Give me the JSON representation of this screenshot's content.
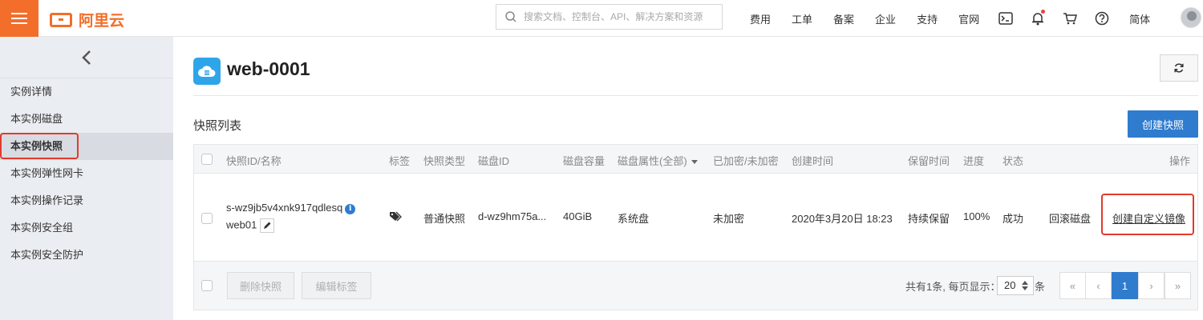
{
  "topbar": {
    "logo_text": "阿里云",
    "search_placeholder": "搜索文档、控制台、API、解决方案和资源",
    "nav_items": [
      "费用",
      "工单",
      "备案",
      "企业",
      "支持",
      "官网"
    ],
    "lang": "简体"
  },
  "sidebar": {
    "items": [
      "实例详情",
      "本实例磁盘",
      "本实例快照",
      "本实例弹性网卡",
      "本实例操作记录",
      "本实例安全组",
      "本实例安全防护"
    ],
    "active_index": 2
  },
  "main": {
    "instance_title": "web-0001",
    "section_title": "快照列表",
    "create_button": "创建快照",
    "columns": [
      "快照ID/名称",
      "标签",
      "快照类型",
      "磁盘ID",
      "磁盘容量",
      "磁盘属性(全部)",
      "已加密/未加密",
      "创建时间",
      "保留时间",
      "进度",
      "状态",
      "操作"
    ],
    "rows": [
      {
        "snapshot_id": "s-wz9jb5v4xnk917qdlesq",
        "snapshot_name": "web01",
        "type": "普通快照",
        "disk_id": "d-wz9hm75a...",
        "capacity": "40GiB",
        "attribute": "系统盘",
        "encryption": "未加密",
        "created": "2020年3月20日 18:23",
        "retention": "持续保留",
        "progress": "100%",
        "status": "成功",
        "action_rollback": "回滚磁盘",
        "action_create_image": "创建自定义镜像"
      }
    ],
    "footer": {
      "delete_button": "删除快照",
      "edit_tags_button": "编辑标签",
      "total_text": "共有1条, 每页显示：",
      "page_size": "20",
      "page_size_suffix": "条",
      "pages": {
        "first": "«",
        "prev": "‹",
        "current": "1",
        "next": "›",
        "last": "»"
      }
    }
  },
  "colors": {
    "brand_orange": "#f26e2a",
    "primary_blue": "#2f7ccf",
    "link_blue": "#0070cc",
    "highlight_red": "#e23a2c"
  }
}
